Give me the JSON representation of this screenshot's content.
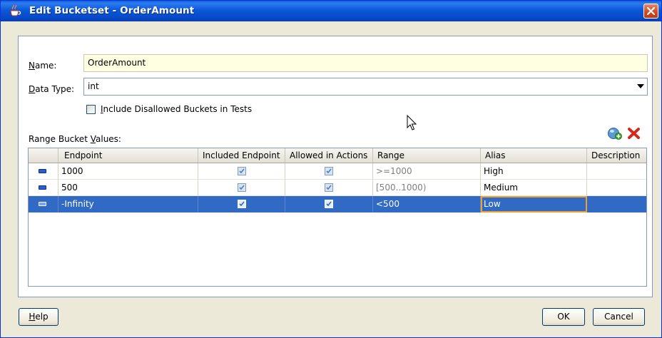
{
  "window": {
    "title": "Edit Bucketset - OrderAmount"
  },
  "form": {
    "name_label_prefix": "",
    "name_label_mnemonic": "N",
    "name_label_rest": "ame:",
    "name_value": "OrderAmount",
    "datatype_label_mnemonic": "D",
    "datatype_label_rest": "ata Type:",
    "datatype_value": "int",
    "include_label_mnemonic": "I",
    "include_label_rest": "nclude Disallowed Buckets in Tests",
    "include_checked": false
  },
  "range": {
    "label_prefix": "Range Bucket ",
    "label_mnemonic": "V",
    "label_rest": "alues:",
    "columns": [
      "Endpoint",
      "Included Endpoint",
      "Allowed in Actions",
      "Range",
      "Alias",
      "Description"
    ],
    "rows": [
      {
        "endpoint": "1000",
        "included": true,
        "allowed": true,
        "range": ">=1000",
        "alias": "High",
        "description": "",
        "selected": false
      },
      {
        "endpoint": "500",
        "included": true,
        "allowed": true,
        "range": "[500..1000)",
        "alias": "Medium",
        "description": "",
        "selected": false
      },
      {
        "endpoint": "-Infinity",
        "included": true,
        "allowed": true,
        "range": "<500",
        "alias": "Low",
        "description": "",
        "selected": true
      }
    ]
  },
  "buttons": {
    "help_mnemonic": "H",
    "help_rest": "elp",
    "ok": "OK",
    "cancel": "Cancel"
  },
  "icons": {
    "add": "add-bucket-icon",
    "delete": "delete-bucket-icon",
    "close": "close-icon",
    "app": "coffee-cup-icon"
  },
  "colors": {
    "title_bar": "#0a5fd8",
    "selection": "#316ac5",
    "name_field_bg": "#ffffe1"
  }
}
